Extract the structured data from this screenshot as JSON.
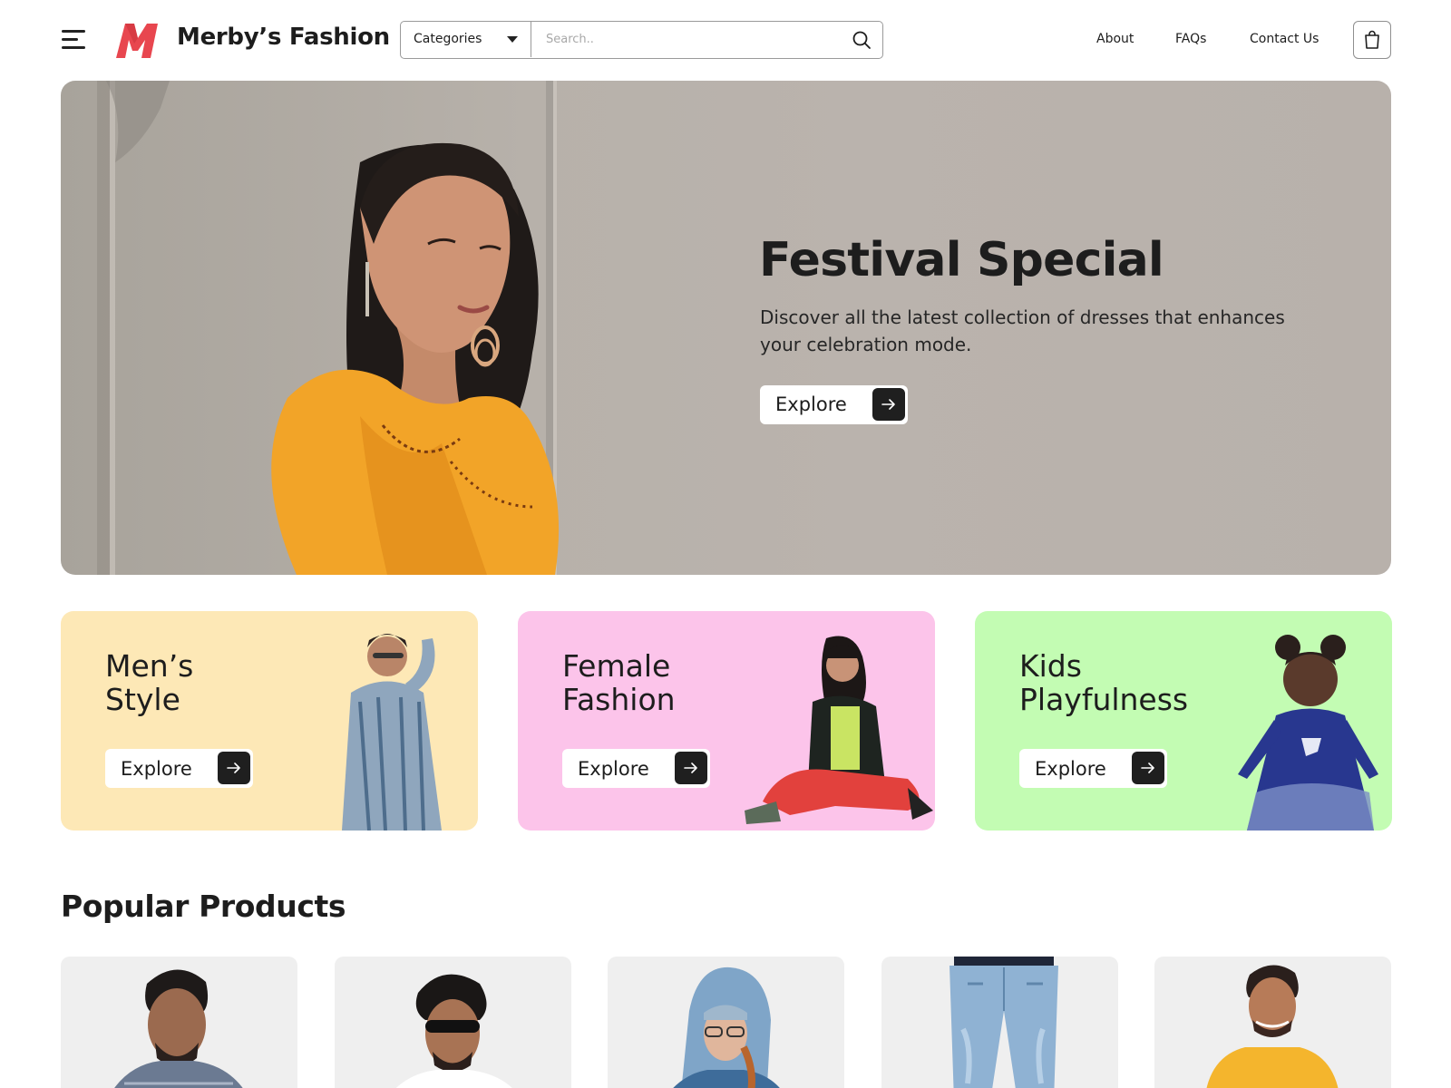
{
  "header": {
    "brand": "Merby’s Fashion",
    "logo_letter": "M",
    "categories_label": "Categories",
    "search_placeholder": "Search..",
    "nav": {
      "about": "About",
      "faqs": "FAQs",
      "contact": "Contact Us"
    },
    "icons": [
      "hamburger-menu-icon",
      "search-icon",
      "shopping-bag-icon",
      "chevron-down-icon"
    ]
  },
  "hero": {
    "title": "Festival Special",
    "description": "Discover all the latest collection of dresses that enhances your celebration mode.",
    "button_label": "Explore"
  },
  "categories": [
    {
      "title": "Men’s\nStyle",
      "button_label": "Explore",
      "color": "#fde8b6"
    },
    {
      "title": "Female\nFashion",
      "button_label": "Explore",
      "color": "#fcc4ea"
    },
    {
      "title": "Kids\nPlayfulness",
      "button_label": "Explore",
      "color": "#c3fcb3"
    }
  ],
  "popular": {
    "title": "Popular Products"
  },
  "colors": {
    "accent_logo": "#e8464f",
    "dark": "#1f1f1f",
    "hero_bg": "#b7b1aa"
  }
}
